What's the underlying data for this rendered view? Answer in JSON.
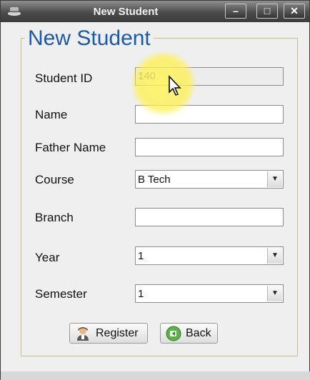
{
  "window": {
    "title": "New Student",
    "minimize_symbol": "–",
    "maximize_symbol": "□",
    "close_symbol": "✕"
  },
  "form": {
    "heading": "New Student",
    "fields": {
      "student_id": {
        "label": "Student ID",
        "value": "140"
      },
      "name": {
        "label": "Name",
        "value": ""
      },
      "father_name": {
        "label": "Father Name",
        "value": ""
      },
      "course": {
        "label": "Course",
        "value": "B Tech"
      },
      "branch": {
        "label": "Branch",
        "value": ""
      },
      "year": {
        "label": "Year",
        "value": "1"
      },
      "semester": {
        "label": "Semester",
        "value": "1"
      }
    }
  },
  "buttons": {
    "register": "Register",
    "back": "Back"
  },
  "icons": {
    "app": "hat-icon",
    "register": "user-icon",
    "back": "back-arrow-icon",
    "dropdown": "chevron-down-icon"
  }
}
